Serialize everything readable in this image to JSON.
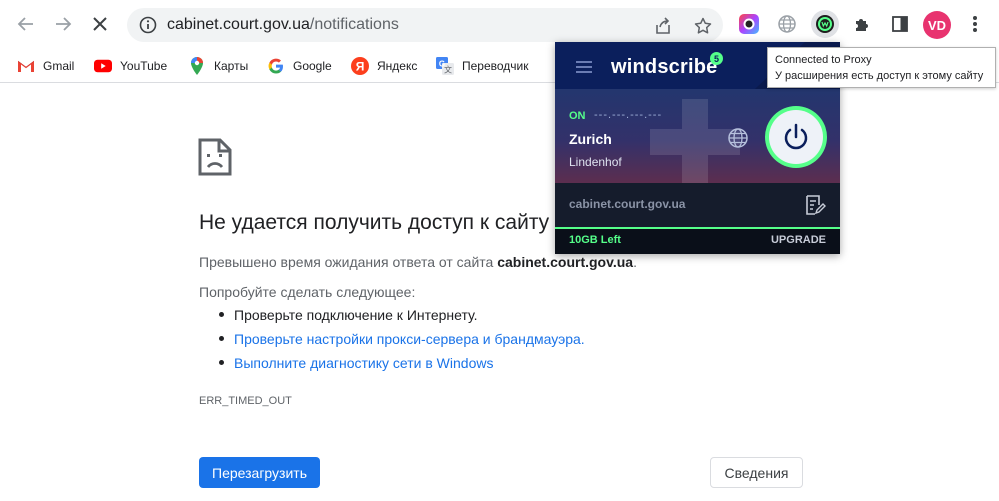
{
  "browser": {
    "url_host": "cabinet.court.gov.ua",
    "url_path": "/notifications",
    "avatar_initials": "VD",
    "accent_color": "#1a73e8"
  },
  "bookmarks": [
    {
      "label": "Gmail",
      "icon": "gmail-icon"
    },
    {
      "label": "YouTube",
      "icon": "youtube-icon"
    },
    {
      "label": "Карты",
      "icon": "maps-icon"
    },
    {
      "label": "Google",
      "icon": "google-icon"
    },
    {
      "label": "Яндекс",
      "icon": "yandex-icon"
    },
    {
      "label": "Переводчик",
      "icon": "translate-icon"
    }
  ],
  "error_page": {
    "title": "Не удается получить доступ к сайту",
    "timeout_prefix": "Превышено время ожидания ответа от сайта ",
    "timeout_host": "cabinet.court.gov.ua",
    "timeout_suffix": ".",
    "try_text": "Попробуйте сделать следующее:",
    "suggestions": [
      "Проверьте подключение к Интернету.",
      "Проверьте настройки прокси-сервера и брандмауэра.",
      "Выполните диагностику сети в Windows"
    ],
    "error_code": "ERR_TIMED_OUT",
    "reload_label": "Перезагрузить",
    "details_label": "Сведения"
  },
  "windscribe": {
    "logo": "windscribe",
    "badge": "5",
    "status": "ON",
    "ip": "---.---.---.---",
    "city": "Zurich",
    "node": "Lindenhof",
    "site": "cabinet.court.gov.ua",
    "data_left": "10GB Left",
    "upgrade_label": "UPGRADE",
    "status_color": "#55ff8a"
  },
  "tooltip": {
    "line1": "Connected to Proxy",
    "line2": "У расширения есть доступ к этому сайту"
  }
}
